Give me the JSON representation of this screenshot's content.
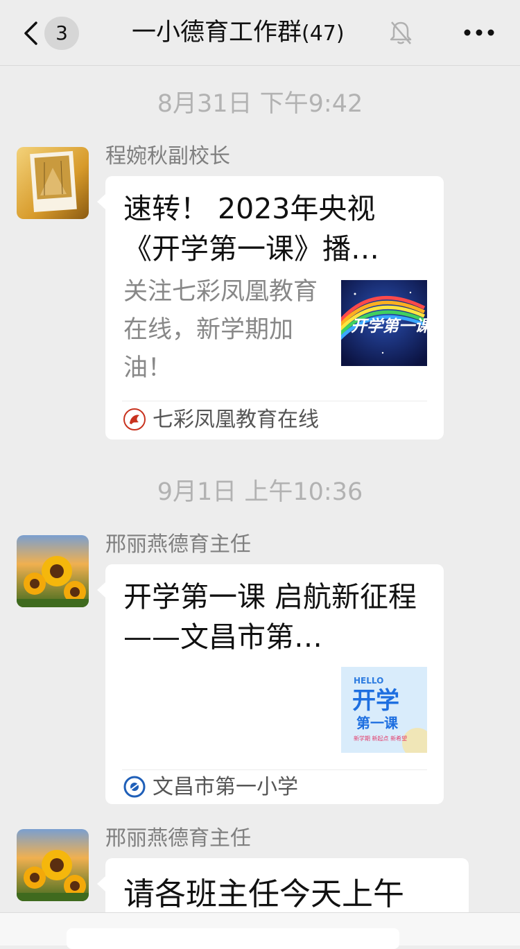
{
  "header": {
    "back_icon": "chevron-left-icon",
    "unread_count": "3",
    "title": "一小德育工作群",
    "member_count": "(47)",
    "mute_icon": "bell-muted-icon",
    "more_icon": "ellipsis-icon"
  },
  "timestamps": [
    "8月31日 下午9:42",
    "9月1日 上午10:36"
  ],
  "messages": [
    {
      "sender": "程婉秋副校长",
      "avatar_icon": "avatar-photo",
      "type": "link-card",
      "title": "速转！ 2023年央视《开学第一课》播…",
      "description": "关注七彩凤凰教育在线，新学期加油！",
      "thumb_text": "开学第一课",
      "source": "七彩凤凰教育在线",
      "source_icon": "phoenix-seal-icon"
    },
    {
      "sender": "邢丽燕德育主任",
      "avatar_icon": "sunflower-avatar",
      "type": "link-card",
      "title": "开学第一课 启航新征程——文昌市第…",
      "description": "",
      "thumb_hello": "HELLO",
      "thumb_main": "开学",
      "thumb_sub": "第一课",
      "thumb_tag": "新学期 新起点 新希望",
      "source": "文昌市第一小学",
      "source_icon": "school-logo-icon"
    },
    {
      "sender": "邢丽燕德育主任",
      "avatar_icon": "sunflower-avatar",
      "type": "text",
      "text": "请各班主任今天上午"
    }
  ],
  "colors": {
    "background": "#ededed",
    "bubble": "#ffffff",
    "timestamp": "#b2b2b2",
    "sender": "#7f7f7f"
  }
}
